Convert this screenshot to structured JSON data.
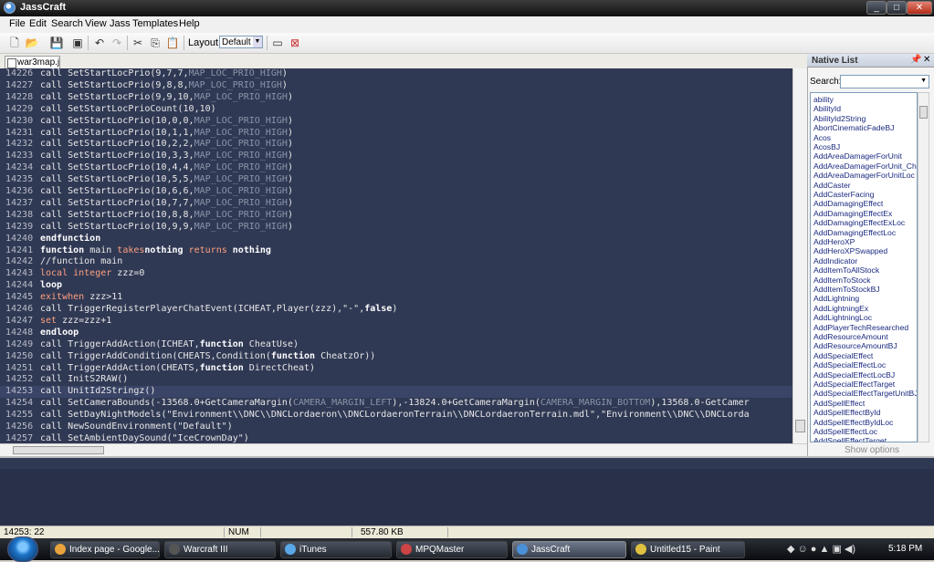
{
  "window": {
    "title": "JassCraft"
  },
  "menu": [
    "File",
    "Edit",
    "Search",
    "View",
    "Jass",
    "Templates",
    "Help"
  ],
  "toolbar": {
    "layout_label": "Layout:",
    "layout_value": "Default"
  },
  "tab": {
    "name": "war3map.j"
  },
  "editor": {
    "lines": [
      {
        "n": "14226",
        "t": [
          [
            "",
            "call SetStartLocPrio(9,7,7,"
          ],
          [
            "cn",
            "MAP_LOC_PRIO_HIGH"
          ],
          [
            "",
            ")"
          ]
        ]
      },
      {
        "n": "14227",
        "t": [
          [
            "",
            "call SetStartLocPrio(9,8,8,"
          ],
          [
            "cn",
            "MAP_LOC_PRIO_HIGH"
          ],
          [
            "",
            ")"
          ]
        ]
      },
      {
        "n": "14228",
        "t": [
          [
            "",
            "call SetStartLocPrio(9,9,10,"
          ],
          [
            "cn",
            "MAP_LOC_PRIO_HIGH"
          ],
          [
            "",
            ")"
          ]
        ]
      },
      {
        "n": "14229",
        "t": [
          [
            "",
            "call SetStartLocPrioCount(10,10)"
          ]
        ]
      },
      {
        "n": "14230",
        "t": [
          [
            "",
            "call SetStartLocPrio(10,0,0,"
          ],
          [
            "cn",
            "MAP_LOC_PRIO_HIGH"
          ],
          [
            "",
            ")"
          ]
        ]
      },
      {
        "n": "14231",
        "t": [
          [
            "",
            "call SetStartLocPrio(10,1,1,"
          ],
          [
            "cn",
            "MAP_LOC_PRIO_HIGH"
          ],
          [
            "",
            ")"
          ]
        ]
      },
      {
        "n": "14232",
        "t": [
          [
            "",
            "call SetStartLocPrio(10,2,2,"
          ],
          [
            "cn",
            "MAP_LOC_PRIO_HIGH"
          ],
          [
            "",
            ")"
          ]
        ]
      },
      {
        "n": "14233",
        "t": [
          [
            "",
            "call SetStartLocPrio(10,3,3,"
          ],
          [
            "cn",
            "MAP_LOC_PRIO_HIGH"
          ],
          [
            "",
            ")"
          ]
        ]
      },
      {
        "n": "14234",
        "t": [
          [
            "",
            "call SetStartLocPrio(10,4,4,"
          ],
          [
            "cn",
            "MAP_LOC_PRIO_HIGH"
          ],
          [
            "",
            ")"
          ]
        ]
      },
      {
        "n": "14235",
        "t": [
          [
            "",
            "call SetStartLocPrio(10,5,5,"
          ],
          [
            "cn",
            "MAP_LOC_PRIO_HIGH"
          ],
          [
            "",
            ")"
          ]
        ]
      },
      {
        "n": "14236",
        "t": [
          [
            "",
            "call SetStartLocPrio(10,6,6,"
          ],
          [
            "cn",
            "MAP_LOC_PRIO_HIGH"
          ],
          [
            "",
            ")"
          ]
        ]
      },
      {
        "n": "14237",
        "t": [
          [
            "",
            "call SetStartLocPrio(10,7,7,"
          ],
          [
            "cn",
            "MAP_LOC_PRIO_HIGH"
          ],
          [
            "",
            ")"
          ]
        ]
      },
      {
        "n": "14238",
        "t": [
          [
            "",
            "call SetStartLocPrio(10,8,8,"
          ],
          [
            "cn",
            "MAP_LOC_PRIO_HIGH"
          ],
          [
            "",
            ")"
          ]
        ]
      },
      {
        "n": "14239",
        "t": [
          [
            "",
            "call SetStartLocPrio(10,9,9,"
          ],
          [
            "cn",
            "MAP_LOC_PRIO_HIGH"
          ],
          [
            "",
            ")"
          ]
        ]
      },
      {
        "n": "14240",
        "t": [
          [
            "kw",
            "endfunction"
          ]
        ]
      },
      {
        "n": "14241",
        "t": [
          [
            "kw",
            "function"
          ],
          [
            "",
            " main "
          ],
          [
            "kw2",
            "takes"
          ],
          [
            "",
            "",
            " "
          ],
          [
            "kw",
            "nothing"
          ],
          [
            "",
            " "
          ],
          [
            "kw2",
            "returns"
          ],
          [
            "",
            " "
          ],
          [
            "kw",
            "nothing"
          ]
        ]
      },
      {
        "n": "14242",
        "t": [
          [
            "",
            "//function main"
          ]
        ]
      },
      {
        "n": "14243",
        "t": [
          [
            "kw2",
            "local integer"
          ],
          [
            "",
            " zzz=0"
          ]
        ]
      },
      {
        "n": "14244",
        "t": [
          [
            "kw",
            "loop"
          ]
        ]
      },
      {
        "n": "14245",
        "t": [
          [
            "kw2",
            "exitwhen"
          ],
          [
            "",
            " zzz>11"
          ]
        ]
      },
      {
        "n": "14246",
        "t": [
          [
            "",
            "call TriggerRegisterPlayerChatEvent(ICHEAT,Player(zzz),\"-\","
          ],
          [
            "kw",
            "false"
          ],
          [
            "",
            ")"
          ]
        ]
      },
      {
        "n": "14247",
        "t": [
          [
            "kw2",
            "set"
          ],
          [
            "",
            " zzz=zzz+1"
          ]
        ]
      },
      {
        "n": "14248",
        "t": [
          [
            "kw",
            "endloop"
          ]
        ]
      },
      {
        "n": "14249",
        "t": [
          [
            "",
            "call TriggerAddAction(ICHEAT,"
          ],
          [
            "kw",
            "function"
          ],
          [
            "",
            " CheatUse)"
          ]
        ]
      },
      {
        "n": "14250",
        "t": [
          [
            "",
            "call TriggerAddCondition(CHEATS,Condition("
          ],
          [
            "kw",
            "function"
          ],
          [
            "",
            " CheatzOr))"
          ]
        ]
      },
      {
        "n": "14251",
        "t": [
          [
            "",
            "call TriggerAddAction(CHEATS,"
          ],
          [
            "kw",
            "function"
          ],
          [
            "",
            " DirectCheat)"
          ]
        ]
      },
      {
        "n": "14252",
        "t": [
          [
            "",
            "call InitS2RAW()"
          ]
        ]
      },
      {
        "n": "14253",
        "t": [
          [
            "",
            "call UnitId2Stringz()"
          ]
        ]
      },
      {
        "n": "14254",
        "t": [
          [
            "",
            "call SetCameraBounds(-13568.0+GetCameraMargin("
          ],
          [
            "cn",
            "CAMERA_MARGIN_LEFT"
          ],
          [
            "",
            "),-13824.0+GetCameraMargin("
          ],
          [
            "cn",
            "CAMERA_MARGIN_BOTTOM"
          ],
          [
            "",
            "),13568.0-GetCamer"
          ]
        ]
      },
      {
        "n": "14255",
        "t": [
          [
            "",
            "call SetDayNightModels(\"Environment\\\\DNC\\\\DNCLordaeron\\\\DNCLordaeronTerrain\\\\DNCLordaeronTerrain.mdl\",\"Environment\\\\DNC\\\\DNCLorda"
          ]
        ]
      },
      {
        "n": "14256",
        "t": [
          [
            "",
            "call NewSoundEnvironment(\"Default\")"
          ]
        ]
      },
      {
        "n": "14257",
        "t": [
          [
            "",
            "call SetAmbientDaySound(\"IceCrownDay\")"
          ]
        ]
      }
    ]
  },
  "native_list": {
    "title": "Native List",
    "search_label": "Search:",
    "show_options": "Show options",
    "items": [
      "ability",
      "AbilityId",
      "AbilityId2String",
      "AbortCinematicFadeBJ",
      "Acos",
      "AcosBJ",
      "AddAreaDamagerForUnit",
      "AddAreaDamagerForUnit_Chi",
      "AddAreaDamagerForUnitLoc",
      "AddCaster",
      "AddCasterFacing",
      "AddDamagingEffect",
      "AddDamagingEffectEx",
      "AddDamagingEffectExLoc",
      "AddDamagingEffectLoc",
      "AddHeroXP",
      "AddHeroXPSwapped",
      "AddIndicator",
      "AddItemToAllStock",
      "AddItemToStock",
      "AddItemToStockBJ",
      "AddLightning",
      "AddLightningEx",
      "AddLightningLoc",
      "AddPlayerTechResearched",
      "AddResourceAmount",
      "AddResourceAmountBJ",
      "AddSpecialEffect",
      "AddSpecialEffectLoc",
      "AddSpecialEffectLocBJ",
      "AddSpecialEffectTarget",
      "AddSpecialEffectTargetUnitBJ",
      "AddSpellEffect",
      "AddSpellEffectById",
      "AddSpellEffectByIdLoc",
      "AddSpellEffectLoc",
      "AddSpellEffectTarget"
    ]
  },
  "status": {
    "position": "14253: 22",
    "num": "NUM",
    "size": "557.80 KB"
  },
  "taskbar": {
    "tasks": [
      "Index page - Google...",
      "Warcraft III",
      "iTunes",
      "MPQMaster",
      "JassCraft",
      "Untitled15 - Paint"
    ],
    "clock": "5:18 PM"
  },
  "colors": {
    "editor_bg": "#303954",
    "keyword": "#ffffff",
    "keyword2": "#ff9f7f",
    "constant": "#8c94a8"
  }
}
